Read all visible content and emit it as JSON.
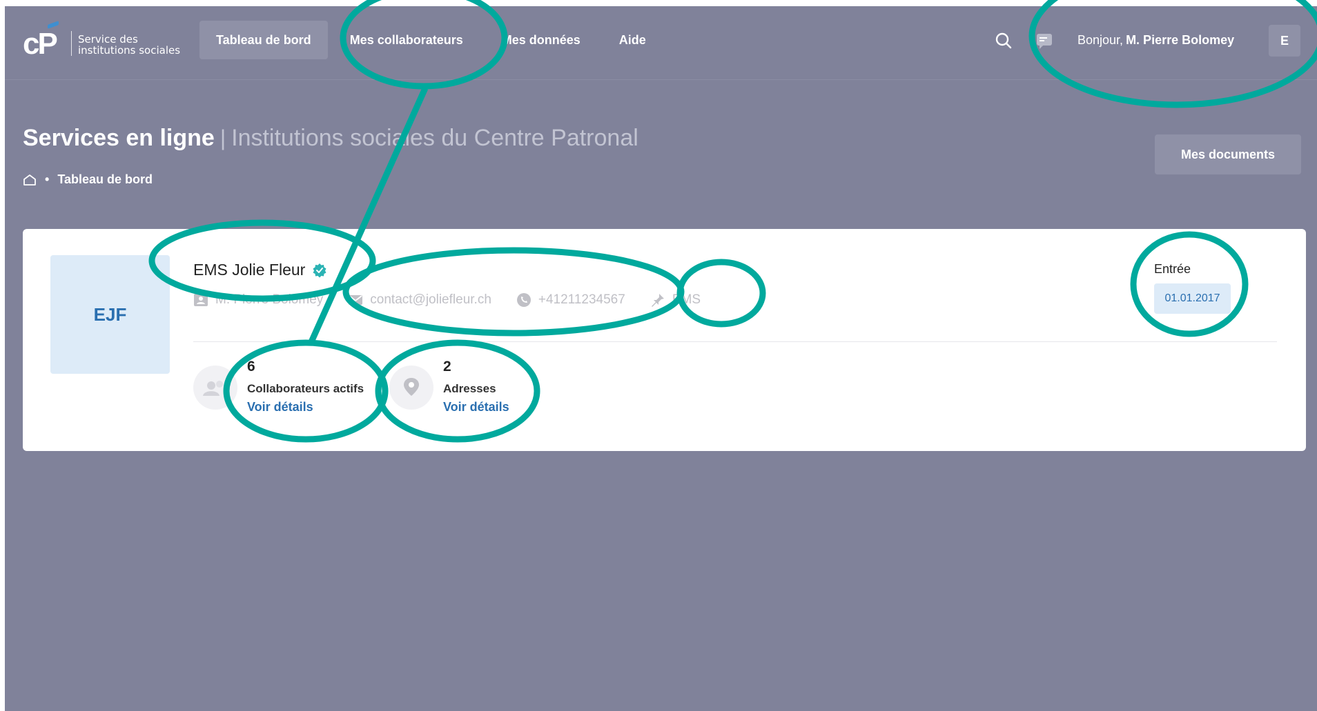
{
  "header": {
    "logo_text_line1": "Service des",
    "logo_text_line2": "institutions sociales",
    "nav": [
      {
        "label": "Tableau de bord",
        "active": true
      },
      {
        "label": "Mes collaborateurs",
        "active": false
      },
      {
        "label": "Mes données",
        "active": false
      },
      {
        "label": "Aide",
        "active": false
      }
    ],
    "greeting": "Bonjour,",
    "user_name": "M. Pierre Bolomey",
    "avatar_letter": "E",
    "icons": [
      "search-icon",
      "chat-icon"
    ]
  },
  "page": {
    "title": "Services en ligne",
    "separator": "|",
    "subtitle": "Institutions sociales du Centre Patronal",
    "breadcrumb_current": "Tableau de bord",
    "breadcrumb_dot": "•",
    "documents_button": "Mes documents"
  },
  "card": {
    "monogram": "EJF",
    "name": "EMS Jolie Fleur",
    "contact_person": "M. Pierre Bolomey",
    "email": "contact@joliefleur.ch",
    "phone": "+41211234567",
    "type": "EMS",
    "stats": [
      {
        "value": "6",
        "label": "Collaborateurs actifs",
        "link": "Voir détails",
        "icon": "users-icon"
      },
      {
        "value": "2",
        "label": "Adresses",
        "link": "Voir détails",
        "icon": "location-pin-icon"
      }
    ],
    "entry_label": "Entrée",
    "entry_date": "01.01.2017"
  },
  "colors": {
    "background": "#80829a",
    "annotation": "#00a99d",
    "accent_blue": "#2a6fb0",
    "light_blue": "#ddebf8"
  }
}
